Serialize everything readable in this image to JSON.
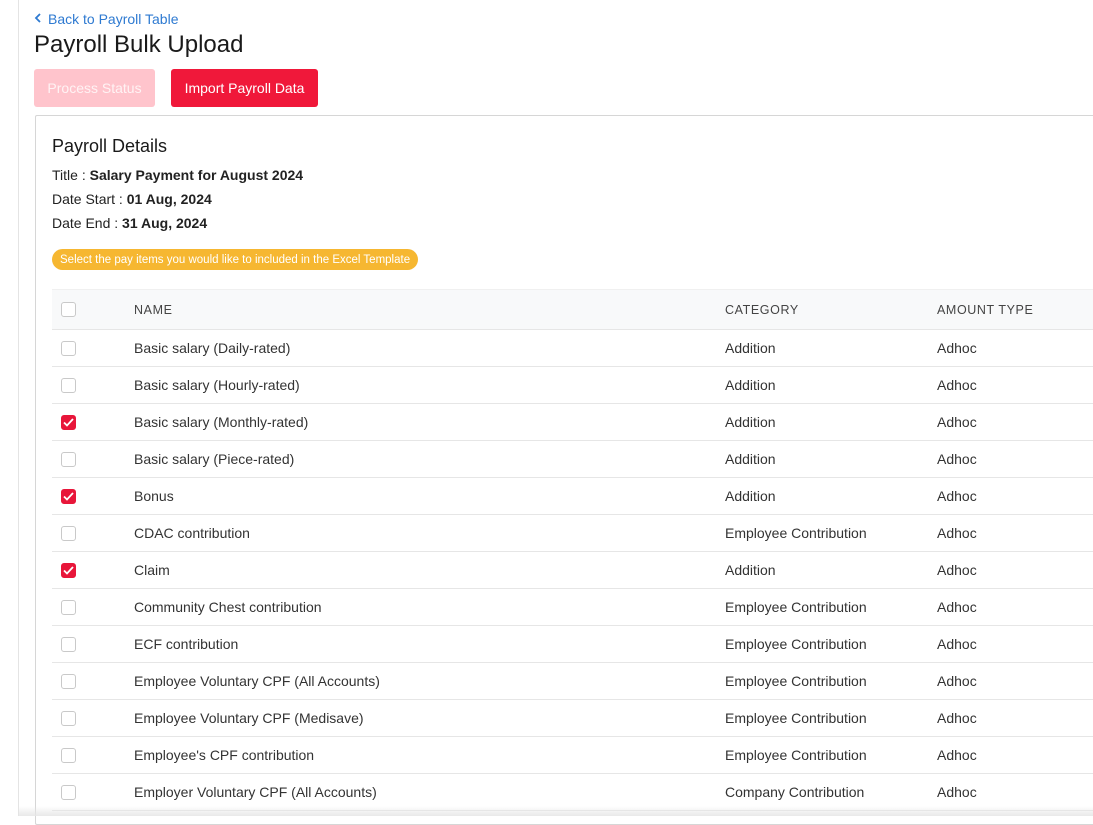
{
  "nav": {
    "back_label": "Back to Payroll Table"
  },
  "page": {
    "title": "Payroll Bulk Upload"
  },
  "toolbar": {
    "process_status_label": "Process Status",
    "import_label": "Import Payroll Data"
  },
  "details": {
    "heading": "Payroll Details",
    "title_label": "Title : ",
    "title_value": "Salary Payment for August 2024",
    "date_start_label": "Date Start : ",
    "date_start_value": "01 Aug, 2024",
    "date_end_label": "Date End : ",
    "date_end_value": "31 Aug, 2024",
    "hint": "Select the pay items you would like to included in the Excel Template"
  },
  "table": {
    "headers": {
      "name": "NAME",
      "category": "CATEGORY",
      "amount_type": "AMOUNT TYPE"
    },
    "rows": [
      {
        "name": "Basic salary (Daily-rated)",
        "category": "Addition",
        "amount_type": "Adhoc",
        "checked": false
      },
      {
        "name": "Basic salary (Hourly-rated)",
        "category": "Addition",
        "amount_type": "Adhoc",
        "checked": false
      },
      {
        "name": "Basic salary (Monthly-rated)",
        "category": "Addition",
        "amount_type": "Adhoc",
        "checked": true
      },
      {
        "name": "Basic salary (Piece-rated)",
        "category": "Addition",
        "amount_type": "Adhoc",
        "checked": false
      },
      {
        "name": "Bonus",
        "category": "Addition",
        "amount_type": "Adhoc",
        "checked": true
      },
      {
        "name": "CDAC contribution",
        "category": "Employee Contribution",
        "amount_type": "Adhoc",
        "checked": false
      },
      {
        "name": "Claim",
        "category": "Addition",
        "amount_type": "Adhoc",
        "checked": true
      },
      {
        "name": "Community Chest contribution",
        "category": "Employee Contribution",
        "amount_type": "Adhoc",
        "checked": false
      },
      {
        "name": "ECF contribution",
        "category": "Employee Contribution",
        "amount_type": "Adhoc",
        "checked": false
      },
      {
        "name": "Employee Voluntary CPF (All Accounts)",
        "category": "Employee Contribution",
        "amount_type": "Adhoc",
        "checked": false
      },
      {
        "name": "Employee Voluntary CPF (Medisave)",
        "category": "Employee Contribution",
        "amount_type": "Adhoc",
        "checked": false
      },
      {
        "name": "Employee's CPF contribution",
        "category": "Employee Contribution",
        "amount_type": "Adhoc",
        "checked": false
      },
      {
        "name": "Employer Voluntary CPF (All Accounts)",
        "category": "Company Contribution",
        "amount_type": "Adhoc",
        "checked": false
      }
    ]
  },
  "colors": {
    "accent": "#f0183a",
    "accent_disabled": "#ffc4cc",
    "link": "#2e7ad1",
    "hint_bg": "#f6b731"
  }
}
